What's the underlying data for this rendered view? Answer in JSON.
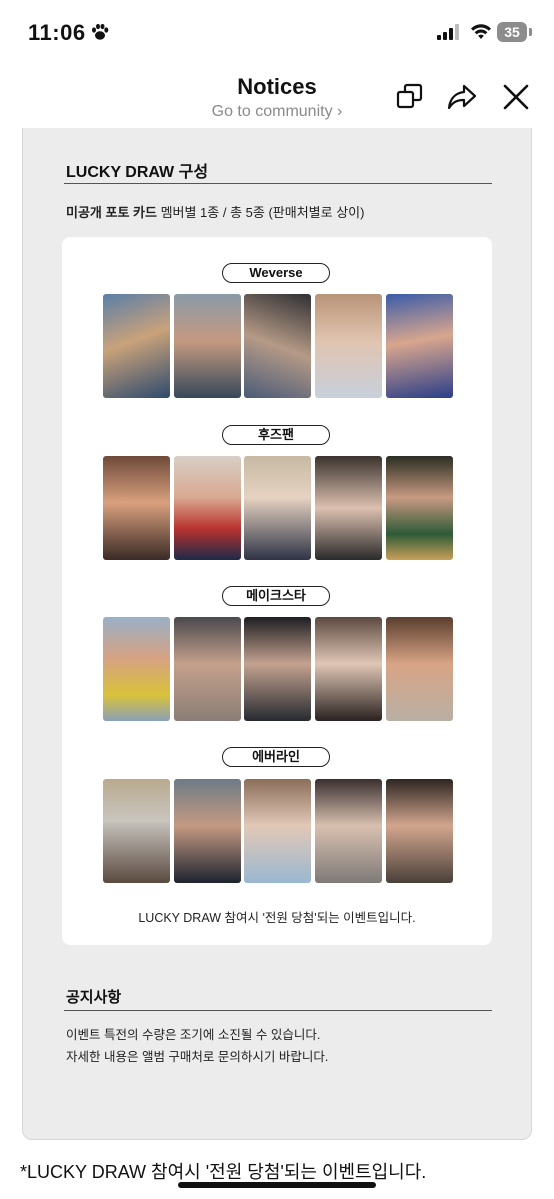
{
  "status_bar": {
    "time": "11:06",
    "battery": "35"
  },
  "header": {
    "title": "Notices",
    "subtitle": "Go to community ›"
  },
  "lucky_draw": {
    "title": "LUCKY DRAW 구성",
    "sub_bold": "미공개 포토 카드",
    "sub_rest": " 멤버별 1종 / 총 5종 (판매처별로 상이)",
    "groups": [
      {
        "label": "Weverse"
      },
      {
        "label": "후즈팬"
      },
      {
        "label": "메이크스타"
      },
      {
        "label": "에버라인"
      }
    ],
    "note": "LUCKY DRAW 참여시 '전원 당첨'되는 이벤트입니다."
  },
  "notice": {
    "title": "공지사항",
    "lines": [
      "이벤트 특전의 수량은 조기에 소진될 수 있습니다.",
      "자세한 내용은 앨범 구매처로 문의하시기 바랍니다."
    ]
  },
  "footer_caption": "*LUCKY DRAW 참여시 '전원 당첨'되는 이벤트입니다."
}
